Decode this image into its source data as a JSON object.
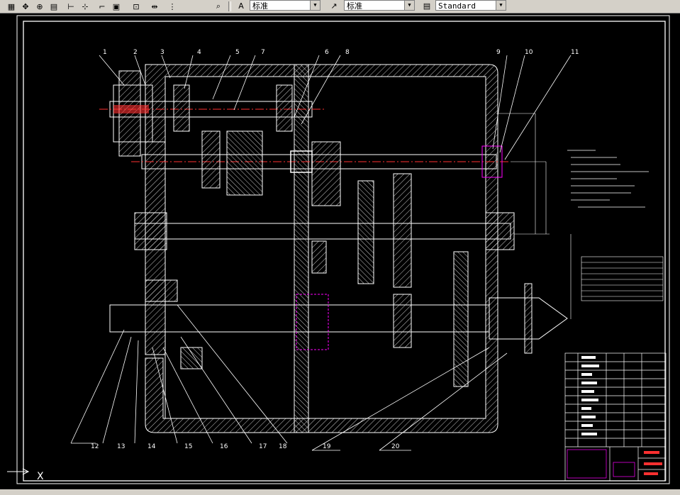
{
  "toolbar": {
    "tools": [
      {
        "name": "grid-icon",
        "glyph": "▦"
      },
      {
        "name": "pan-icon",
        "glyph": "✥"
      },
      {
        "name": "zoom-icon",
        "glyph": "⊕"
      },
      {
        "name": "properties-icon",
        "glyph": "▤"
      },
      {
        "name": "align-icon",
        "glyph": "⊢"
      },
      {
        "name": "dimension-icon",
        "glyph": "⊹"
      },
      {
        "name": "edit-icon",
        "glyph": "⌐"
      },
      {
        "name": "layer-icon",
        "glyph": "▣"
      },
      {
        "name": "block-icon",
        "glyph": "⊡"
      },
      {
        "name": "move-icon",
        "glyph": "⇹"
      },
      {
        "name": "snap-icon",
        "glyph": "⋮"
      }
    ],
    "text_style_icon": "text-style-icon",
    "text_style_value": "标准",
    "dim_style_icon": "dim-style-icon",
    "dim_style_value": "标准",
    "table_style_icon": "table-style-icon",
    "table_style_value": "Standard"
  },
  "drawing": {
    "part_numbers_top": [
      "1",
      "2",
      "3",
      "4",
      "5",
      "7",
      "6",
      "8",
      "9",
      "10",
      "11"
    ],
    "part_numbers_bottom": [
      "12",
      "13",
      "14",
      "15",
      "16",
      "17",
      "18",
      "19",
      "20"
    ],
    "ucs_label": "X"
  },
  "colors": {
    "background": "#000000",
    "line": "#ffffff",
    "centerline": "#ff3030",
    "magenta": "#ff00ff",
    "toolbar": "#d4d0c8"
  }
}
